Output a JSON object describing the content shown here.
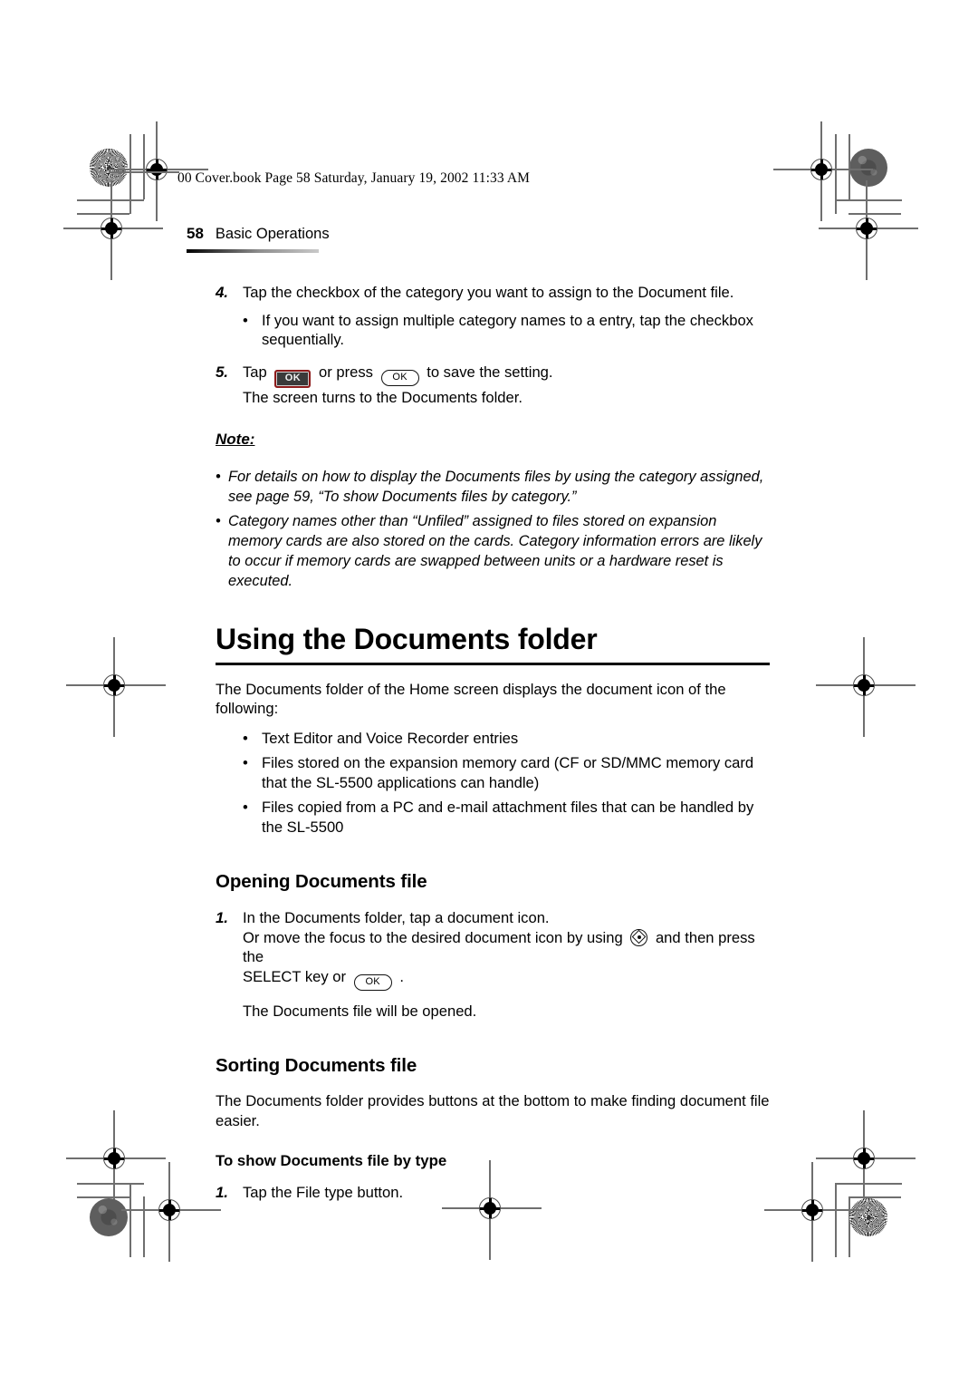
{
  "document": {
    "file_stamp": "00 Cover.book  Page 58  Saturday, January 19, 2002  11:33 AM",
    "running_head": {
      "folio": "58",
      "section_title": "Basic Operations"
    }
  },
  "steps": {
    "step4": {
      "number": "4.",
      "text": "Tap the checkbox of the category you want to assign to the Document file.",
      "bullets": [
        {
          "mark": "•",
          "text": "If you want to assign multiple category names to a entry, tap the checkbox sequentially."
        }
      ]
    },
    "step5": {
      "number": "5.",
      "lead": "Tap",
      "mid": "or press",
      "tail": "to save the setting.",
      "line2": "The screen turns to the Documents folder.",
      "ok_button_label": "OK",
      "ok_key_label": "OK"
    }
  },
  "note": {
    "heading": "Note:",
    "items": [
      {
        "mark": "•",
        "text": "For details on how to display the Documents files by using the category assigned, see page 59, “To show Documents files by category.”"
      },
      {
        "mark": "•",
        "text": "Category names other than “Unfiled” assigned to files stored on expansion memory cards are also stored on the cards. Category information errors are likely to occur if memory cards are swapped between units or a hardware reset is executed."
      }
    ]
  },
  "section_using": {
    "heading": "Using the Documents folder",
    "intro": "The Documents folder of the Home screen displays the document icon of the following:",
    "bullets": [
      {
        "mark": "•",
        "text": "Text Editor and Voice Recorder entries"
      },
      {
        "mark": "•",
        "text": "Files stored on the expansion memory card (CF or SD/MMC memory card that the SL-5500 applications can handle)"
      },
      {
        "mark": "•",
        "text": "Files copied from a PC and e-mail attachment files that can be handled by the SL-5500"
      }
    ]
  },
  "section_opening": {
    "heading": "Opening Documents file",
    "step1": {
      "number": "1.",
      "line1": "In the Documents folder, tap a document icon.",
      "line2a": "Or move the focus to the desired document icon by using",
      "line2b": "and then press the",
      "line3a": "SELECT key or",
      "line3b": ".",
      "ok_key_label": "OK",
      "nav_icon": "navigation-pad-icon",
      "result": "The Documents file will be opened."
    }
  },
  "section_sorting": {
    "heading": "Sorting Documents file",
    "intro": "The Documents folder provides buttons at the bottom to make finding document file easier.",
    "subheading": "To show Documents file by type",
    "step1": {
      "number": "1.",
      "text": "Tap the File type button."
    }
  },
  "colors": {
    "ink": "#000000",
    "mark_gray": "#6f6f6f",
    "button_frame_red": "#8e1b1b",
    "button_face": "#3a3a3a"
  }
}
